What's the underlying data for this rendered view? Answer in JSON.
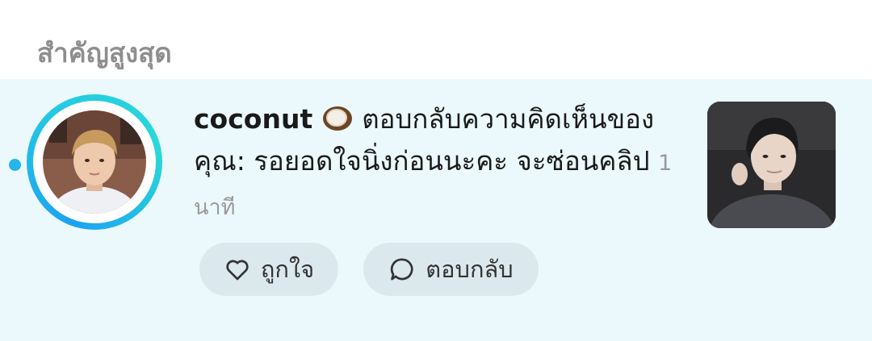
{
  "section": {
    "title": "สำคัญสูงสุด"
  },
  "notification": {
    "username": "coconut",
    "username_emoji": "coconut-icon",
    "message": "ตอบกลับความคิดเห็นของคุณ: รอยอดใจนิ่งก่อนนะคะ จะซ่อนคลิป",
    "time": "1 นาที",
    "unread": true,
    "avatar": "user-avatar-photo",
    "thumbnail": "video-thumbnail-photo"
  },
  "actions": {
    "like_label": "ถูกใจ",
    "like_icon": "heart-icon",
    "reply_label": "ตอบกลับ",
    "reply_icon": "comment-bubble-icon"
  },
  "colors": {
    "row_background": "#ecf9fc",
    "accent": "#25b5ea",
    "header_text": "#8e8e8e",
    "button_background": "#dbe9ef"
  }
}
